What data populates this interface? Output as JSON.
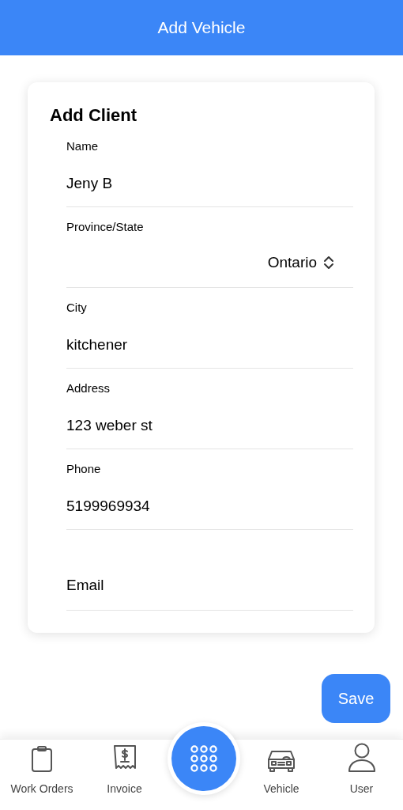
{
  "header": {
    "title": "Add Vehicle"
  },
  "form": {
    "title": "Add Client",
    "fields": [
      {
        "kind": "text",
        "label": "Name",
        "value": "Jeny B"
      },
      {
        "kind": "select",
        "label": "Province/State",
        "value": "Ontario"
      },
      {
        "kind": "text",
        "label": "City",
        "value": "kitchener"
      },
      {
        "kind": "text",
        "label": "Address",
        "value": "123 weber st"
      },
      {
        "kind": "text",
        "label": "Phone",
        "value": "5199969934"
      },
      {
        "kind": "empty",
        "placeholder": "Email"
      }
    ]
  },
  "save_button": "Save",
  "tab_bar": [
    {
      "kind": "clipboard",
      "label": "Work Orders"
    },
    {
      "kind": "receipt",
      "label": "Invoice"
    },
    {
      "kind": "center"
    },
    {
      "kind": "car",
      "label": "Vehicle"
    },
    {
      "kind": "user",
      "label": "User"
    }
  ]
}
